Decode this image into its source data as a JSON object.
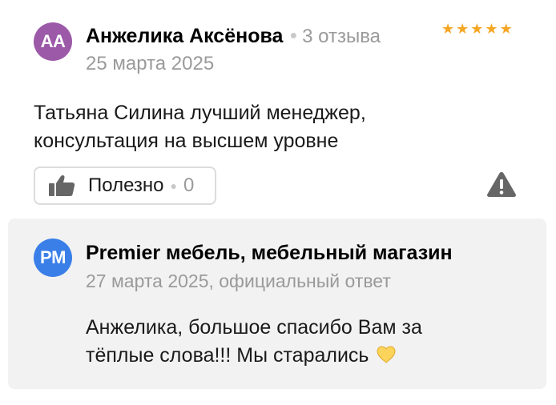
{
  "review": {
    "avatar_initials": "АА",
    "author_name": "Анжелика Аксёнова",
    "review_count": "3 отзыва",
    "date": "25 марта 2025",
    "rating": 5,
    "text_line1": "Татьяна Силина лучший менеджер,",
    "text_line2": "консультация на высшем уровне",
    "useful_label": "Полезно",
    "useful_count": "0"
  },
  "reply": {
    "avatar_initials": "PM",
    "owner_name": "Premier мебель, мебельный магазин",
    "meta": "27 марта 2025, официальный ответ",
    "text_line1": "Анжелика, большое спасибо Вам за",
    "text_line2": "тёплые слова!!! Мы старались"
  },
  "icons": {
    "thumb": "thumbs-up-icon",
    "warning": "warning-icon",
    "heart": "yellow-heart-icon",
    "star": "star-icon"
  },
  "colors": {
    "author_avatar": "#9b59a8",
    "owner_avatar": "#3a7fe8",
    "star": "#f5a623",
    "reply_background": "#f2f2f2",
    "secondary_text": "#9a9a9a"
  }
}
